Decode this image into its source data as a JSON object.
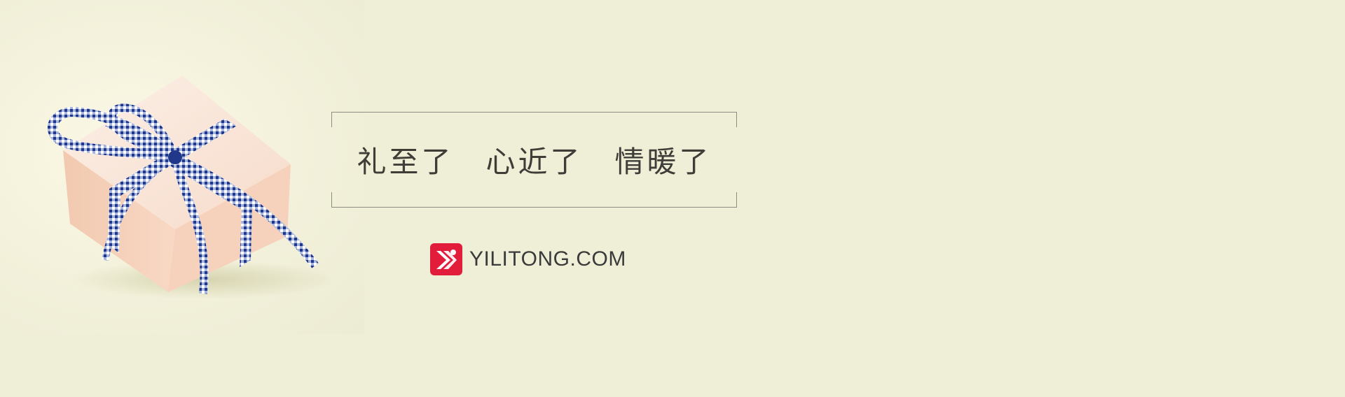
{
  "banner": {
    "tagline": {
      "phrase_1": "礼至了",
      "phrase_2": "心近了",
      "phrase_3": "情暖了"
    },
    "logo": {
      "text": "YILITONG.COM",
      "brand_color": "#e21c3b"
    },
    "image": {
      "subject_icon": "gift-box-with-gingham-ribbon"
    },
    "colors": {
      "background": "#efefd8",
      "ribbon": "#2f4d9a",
      "box": "#f5d2bd"
    }
  }
}
